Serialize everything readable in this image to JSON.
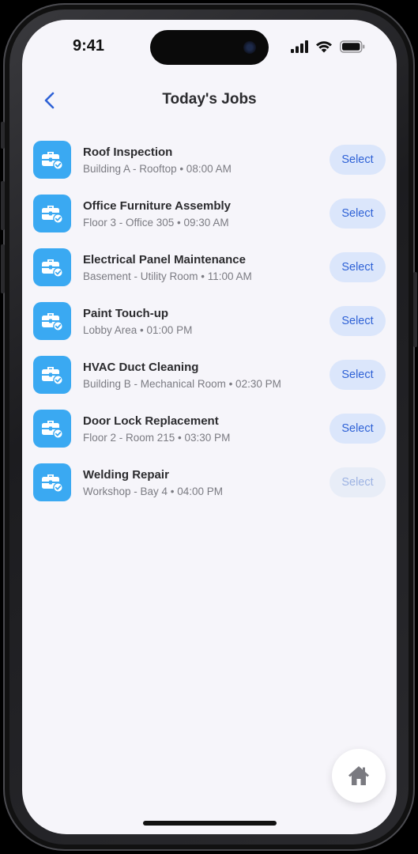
{
  "status_bar": {
    "time": "9:41",
    "icons": [
      "cellular-signal-icon",
      "wifi-icon",
      "battery-icon"
    ]
  },
  "header": {
    "title": "Today's Jobs",
    "back_icon": "chevron-left-icon"
  },
  "colors": {
    "accent": "#3aa9f2",
    "button_bg": "#dbe6fb",
    "button_text": "#2f62d6",
    "background": "#f6f5fa"
  },
  "jobs": [
    {
      "title": "Roof Inspection",
      "subtitle": "Building A - Rooftop • 08:00 AM",
      "button": "Select",
      "icon": "toolbox-check-icon"
    },
    {
      "title": "Office Furniture Assembly",
      "subtitle": "Floor 3 - Office 305 • 09:30 AM",
      "button": "Select",
      "icon": "toolbox-check-icon"
    },
    {
      "title": "Electrical Panel Maintenance",
      "subtitle": "Basement - Utility Room • 11:00 AM",
      "button": "Select",
      "icon": "toolbox-check-icon"
    },
    {
      "title": "Paint Touch-up",
      "subtitle": "Lobby Area • 01:00 PM",
      "button": "Select",
      "icon": "toolbox-check-icon"
    },
    {
      "title": "HVAC Duct Cleaning",
      "subtitle": "Building B - Mechanical Room • 02:30 PM",
      "button": "Select",
      "icon": "toolbox-check-icon"
    },
    {
      "title": "Door Lock Replacement",
      "subtitle": "Floor 2 - Room 215 • 03:30 PM",
      "button": "Select",
      "icon": "toolbox-check-icon"
    },
    {
      "title": "Welding Repair",
      "subtitle": "Workshop - Bay 4 • 04:00 PM",
      "button": "Select",
      "icon": "toolbox-check-icon"
    }
  ],
  "fab": {
    "icon": "home-icon"
  }
}
